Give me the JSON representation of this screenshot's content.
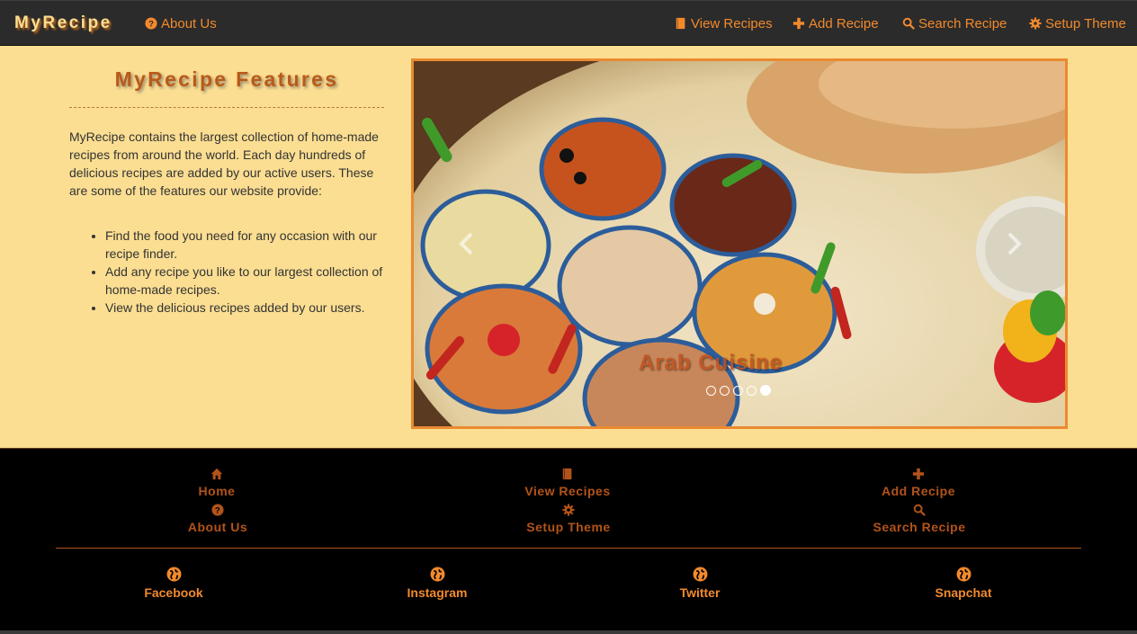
{
  "navbar": {
    "brand": "MyRecipe",
    "about": "About Us",
    "view_recipes": "View Recipes",
    "add_recipe": "Add Recipe",
    "search_recipe": "Search Recipe",
    "setup_theme": "Setup Theme"
  },
  "features": {
    "title": "MyRecipe Features",
    "intro": "MyRecipe contains the largest collection of home-made recipes from around the world. Each day hundreds of delicious recipes are added by our active users. These are some of the features our website provide:",
    "items": [
      "Find the food you need for any occasion with our recipe finder.",
      "Add any recipe you like to our largest collection of home-made recipes.",
      "View the delicious recipes added by our users."
    ]
  },
  "carousel": {
    "caption": "Arab Cuisine",
    "slide_count": 5,
    "active_slide": 5
  },
  "footer": {
    "links": {
      "home": "Home",
      "about": "About Us",
      "view_recipes": "View Recipes",
      "setup_theme": "Setup Theme",
      "add_recipe": "Add Recipe",
      "search_recipe": "Search Recipe"
    },
    "social": {
      "facebook": "Facebook",
      "instagram": "Instagram",
      "twitter": "Twitter",
      "snapchat": "Snapchat"
    }
  },
  "colors": {
    "accent": "#f28a2c",
    "footer_link": "#b2531a",
    "page_bg": "#fbde92",
    "navbar_bg": "#2b2b2b",
    "footer_bg": "#000000"
  },
  "icons": {
    "about": "question-circle-icon",
    "view": "book-icon",
    "add": "plus-icon",
    "search": "search-icon",
    "theme": "gear-icon",
    "home": "home-icon",
    "social": "globe-icon"
  }
}
